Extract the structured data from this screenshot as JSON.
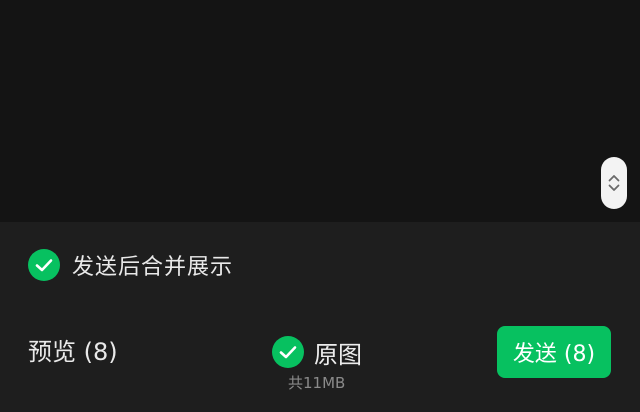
{
  "scroll_handle": {
    "icons": [
      "chevron-up-icon",
      "chevron-down-icon"
    ]
  },
  "merge_option": {
    "label": "发送后合并展示",
    "checked": true
  },
  "footer": {
    "preview_label": "预览 (8)",
    "original_label": "原图",
    "original_checked": true,
    "total_size": "共11MB",
    "send_label": "发送 (8)"
  },
  "colors": {
    "accent": "#07c160",
    "background": "#1e1e1e",
    "text": "#e9e9e9",
    "muted_text": "#8a8a8a"
  }
}
